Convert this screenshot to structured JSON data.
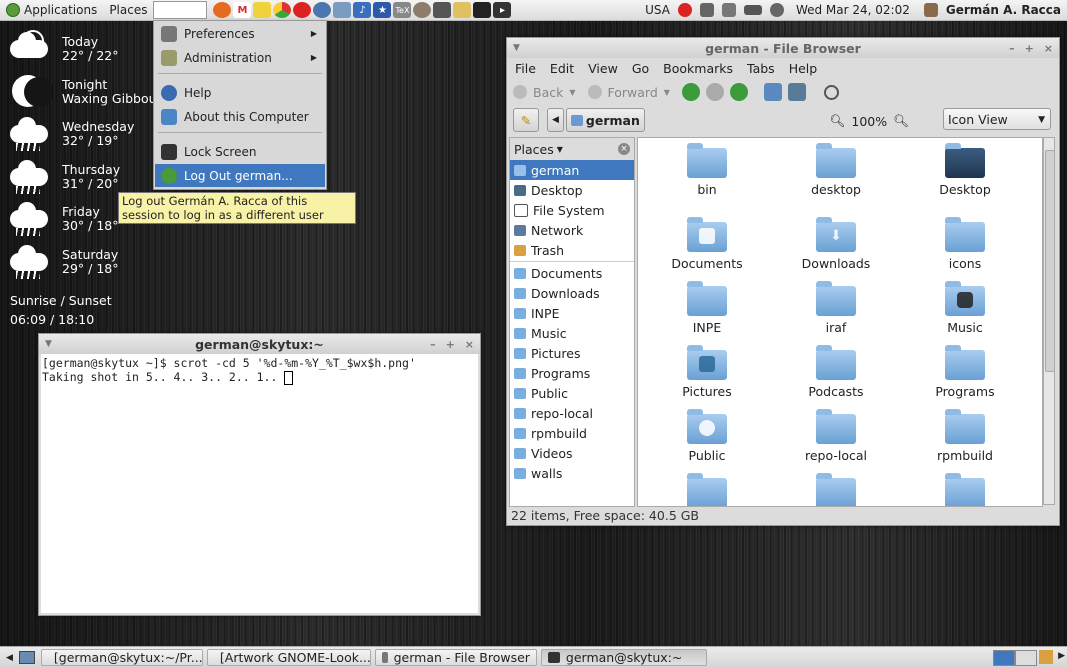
{
  "top_panel": {
    "applications_label": "Applications",
    "places_label": "Places",
    "keyboard_layout": "USA",
    "clock": "Wed Mar 24, 02:02",
    "user": "Germán A. Racca",
    "launchers": [
      "firefox-icon",
      "gmail-icon",
      "notes-icon",
      "chrome-icon",
      "opera-icon",
      "network-icon",
      "files-icon",
      "music-icon",
      "star-icon",
      "tex-icon",
      "gimp-icon",
      "calc-icon",
      "pen-icon",
      "tux-icon",
      "terminal-icon"
    ]
  },
  "weather": {
    "rows": [
      {
        "day": "Today",
        "temps": "22° / 22°",
        "icon": "sun-cloud-icon"
      },
      {
        "day": "Tonight",
        "temps": "Waxing Gibbous",
        "icon": "moon-icon"
      },
      {
        "day": "Wednesday",
        "temps": "32° / 19°",
        "icon": "rain-cloud-icon"
      },
      {
        "day": "Thursday",
        "temps": "31° / 20°",
        "icon": "rain-cloud-icon"
      },
      {
        "day": "Friday",
        "temps": "30° / 18°",
        "icon": "rain-cloud-icon"
      },
      {
        "day": "Saturday",
        "temps": "29° / 18°",
        "icon": "rain-cloud-icon"
      }
    ],
    "sunrise_label": "Sunrise / Sunset",
    "sunrise_times": "06:09 / 18:10"
  },
  "system_menu": {
    "preferences": "Preferences",
    "administration": "Administration",
    "help": "Help",
    "about": "About this Computer",
    "lock": "Lock Screen",
    "logout": "Log Out german..."
  },
  "tooltip": "Log out Germán A. Racca of this session to log in as a different user",
  "terminal": {
    "title": "german@skytux:~",
    "line1": "[german@skytux ~]$ scrot -cd 5 '%d-%m-%Y_%T_$wx$h.png'",
    "line2": "Taking shot in 5.. 4.. 3.. 2.. 1.. "
  },
  "file_browser": {
    "title": "german - File Browser",
    "menus": [
      "File",
      "Edit",
      "View",
      "Go",
      "Bookmarks",
      "Tabs",
      "Help"
    ],
    "back": "Back",
    "forward": "Forward",
    "location": "german",
    "zoom": "100%",
    "view_mode": "Icon View",
    "places_header": "Places",
    "places_system": [
      "german",
      "Desktop",
      "File System",
      "Network",
      "Trash"
    ],
    "places_bookmarks": [
      "Documents",
      "Downloads",
      "INPE",
      "Music",
      "Pictures",
      "Programs",
      "Public",
      "repo-local",
      "rpmbuild",
      "Videos",
      "walls"
    ],
    "items": [
      "bin",
      "desktop",
      "Desktop",
      "Documents",
      "Downloads",
      "icons",
      "INPE",
      "iraf",
      "Music",
      "Pictures",
      "Podcasts",
      "Programs",
      "Public",
      "repo-local",
      "rpmbuild"
    ],
    "status": "22 items, Free space: 40.5 GB"
  },
  "taskbar": {
    "tasks": [
      "[german@skytux:~/Pr...",
      "[Artwork GNOME-Look...",
      "german - File Browser",
      "german@skytux:~"
    ]
  },
  "colors": {
    "selection": "#3f78bf",
    "tooltip_bg": "#f8f2a6",
    "folder": "#7aaee0"
  }
}
